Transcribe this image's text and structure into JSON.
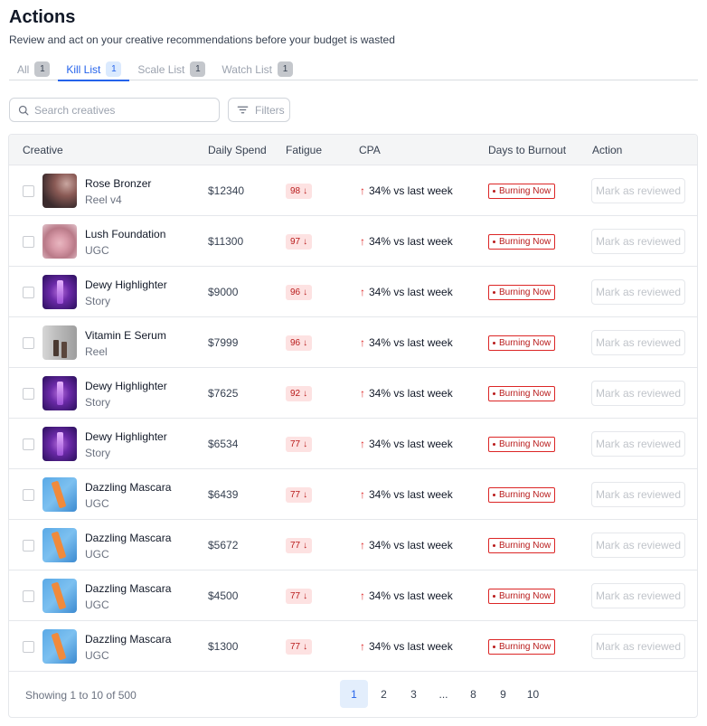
{
  "header": {
    "title": "Actions",
    "subtitle": "Review and act on your creative recommendations before your budget is wasted"
  },
  "tabs": [
    {
      "label": "All",
      "count": "1",
      "active": false
    },
    {
      "label": "Kill List",
      "count": "1",
      "active": true
    },
    {
      "label": "Scale List",
      "count": "1",
      "active": false
    },
    {
      "label": "Watch List",
      "count": "1",
      "active": false
    }
  ],
  "toolbar": {
    "search_placeholder": "Search creatives",
    "filters_label": "Filters"
  },
  "table": {
    "columns": [
      "Creative",
      "Daily Spend",
      "Fatigue",
      "CPA",
      "Days to Burnout",
      "Action"
    ],
    "rows": [
      {
        "name": "Rose Bronzer",
        "type": "Reel v4",
        "thumb": "rose",
        "spend": "$12340",
        "fatigue": "98",
        "cpa": "34% vs last week",
        "burnout": "Burning Now",
        "action": "Mark as reviewed"
      },
      {
        "name": "Lush Foundation",
        "type": "UGC",
        "thumb": "lush",
        "spend": "$11300",
        "fatigue": "97",
        "cpa": "34% vs last week",
        "burnout": "Burning Now",
        "action": "Mark as reviewed"
      },
      {
        "name": "Dewy Highlighter",
        "type": "Story",
        "thumb": "dewy",
        "spend": "$9000",
        "fatigue": "96",
        "cpa": "34% vs last week",
        "burnout": "Burning Now",
        "action": "Mark as reviewed"
      },
      {
        "name": "Vitamin E Serum",
        "type": "Reel",
        "thumb": "vit",
        "spend": "$7999",
        "fatigue": "96",
        "cpa": "34% vs last week",
        "burnout": "Burning Now",
        "action": "Mark as reviewed"
      },
      {
        "name": "Dewy Highlighter",
        "type": "Story",
        "thumb": "dewy",
        "spend": "$7625",
        "fatigue": "92",
        "cpa": "34% vs last week",
        "burnout": "Burning Now",
        "action": "Mark as reviewed"
      },
      {
        "name": "Dewy Highlighter",
        "type": "Story",
        "thumb": "dewy",
        "spend": "$6534",
        "fatigue": "77",
        "cpa": "34% vs last week",
        "burnout": "Burning Now",
        "action": "Mark as reviewed"
      },
      {
        "name": "Dazzling Mascara",
        "type": "UGC",
        "thumb": "masc",
        "spend": "$6439",
        "fatigue": "77",
        "cpa": "34% vs last week",
        "burnout": "Burning Now",
        "action": "Mark as reviewed"
      },
      {
        "name": "Dazzling Mascara",
        "type": "UGC",
        "thumb": "masc",
        "spend": "$5672",
        "fatigue": "77",
        "cpa": "34% vs last week",
        "burnout": "Burning Now",
        "action": "Mark as reviewed"
      },
      {
        "name": "Dazzling Mascara",
        "type": "UGC",
        "thumb": "masc",
        "spend": "$4500",
        "fatigue": "77",
        "cpa": "34% vs last week",
        "burnout": "Burning Now",
        "action": "Mark as reviewed"
      },
      {
        "name": "Dazzling Mascara",
        "type": "UGC",
        "thumb": "masc",
        "spend": "$1300",
        "fatigue": "77",
        "cpa": "34% vs last week",
        "burnout": "Burning Now",
        "action": "Mark as reviewed"
      }
    ]
  },
  "pagination": {
    "summary": "Showing 1 to 10 of 500",
    "pages": [
      "1",
      "2",
      "3",
      "...",
      "8",
      "9",
      "10"
    ],
    "current": "1"
  },
  "icons": {
    "search": "search-icon",
    "filters": "filter-lines-icon",
    "fatigue_trend": "arrow-down-icon",
    "cpa_trend": "arrow-up-icon"
  },
  "colors": {
    "accent": "#2563eb",
    "danger": "#dc2626",
    "fatigue_bg": "#fde2e2"
  }
}
